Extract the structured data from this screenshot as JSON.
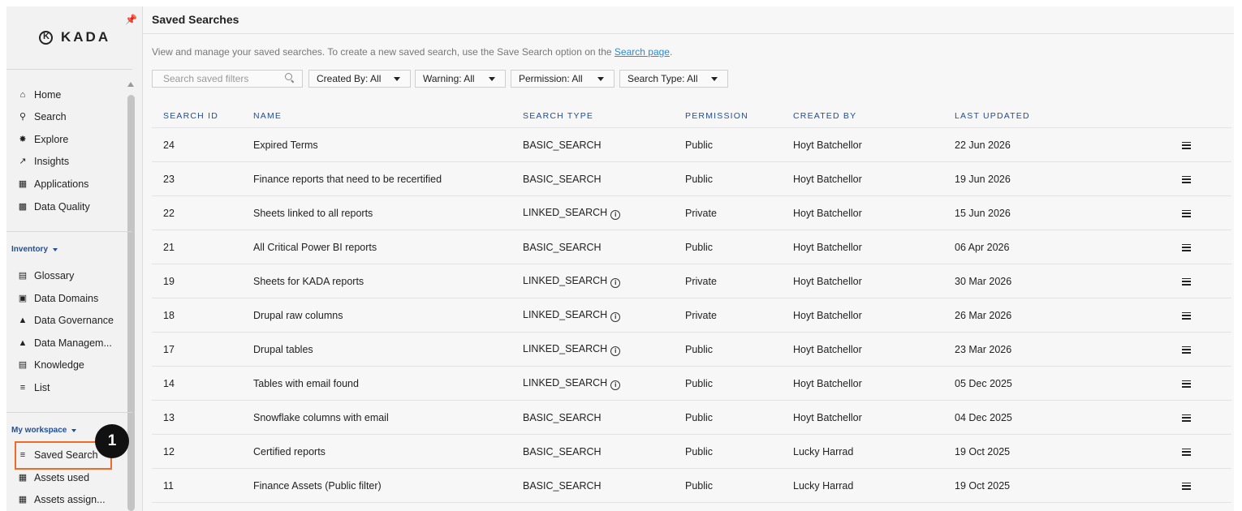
{
  "sidebar": {
    "logo_text": "KADA",
    "primary_nav": [
      {
        "label": "Home",
        "icon": "home-icon"
      },
      {
        "label": "Search",
        "icon": "search-icon"
      },
      {
        "label": "Explore",
        "icon": "explore-icon"
      },
      {
        "label": "Insights",
        "icon": "insights-icon"
      },
      {
        "label": "Applications",
        "icon": "applications-icon"
      },
      {
        "label": "Data Quality",
        "icon": "data-quality-icon"
      }
    ],
    "inventory_label": "Inventory",
    "inventory_nav": [
      {
        "label": "Glossary",
        "icon": "glossary-icon"
      },
      {
        "label": "Data Domains",
        "icon": "data-domains-icon"
      },
      {
        "label": "Data Governance",
        "icon": "data-governance-icon"
      },
      {
        "label": "Data Managem...",
        "icon": "data-management-icon"
      },
      {
        "label": "Knowledge",
        "icon": "knowledge-icon"
      },
      {
        "label": "List",
        "icon": "list-icon"
      }
    ],
    "workspace_label": "My workspace",
    "workspace_nav": [
      {
        "label": "Saved Search",
        "icon": "filter-icon"
      },
      {
        "label": "Assets used",
        "icon": "table-icon"
      },
      {
        "label": "Assets assign...",
        "icon": "table-icon"
      }
    ],
    "step_badge": "1"
  },
  "header": {
    "title": "Saved Searches",
    "subtitle_text": "View and manage your saved searches. To create a new saved search, use the Save Search option on the ",
    "subtitle_link": "Search page",
    "subtitle_end": "."
  },
  "filters": {
    "search_placeholder": "Search saved filters",
    "created_by": "Created By: All",
    "warning": "Warning: All",
    "permission": "Permission: All",
    "search_type": "Search Type: All"
  },
  "table": {
    "columns": [
      "SEARCH ID",
      "NAME",
      "SEARCH TYPE",
      "PERMISSION",
      "CREATED BY",
      "LAST UPDATED"
    ],
    "rows": [
      {
        "id": "24",
        "name": "Expired Terms",
        "type": "BASIC_SEARCH",
        "info": false,
        "permission": "Public",
        "created_by": "Hoyt Batchellor",
        "updated": "22 Jun 2026"
      },
      {
        "id": "23",
        "name": "Finance reports that need to be recertified",
        "type": "BASIC_SEARCH",
        "info": false,
        "permission": "Public",
        "created_by": "Hoyt Batchellor",
        "updated": "19 Jun 2026"
      },
      {
        "id": "22",
        "name": "Sheets linked to all reports",
        "type": "LINKED_SEARCH",
        "info": true,
        "permission": "Private",
        "created_by": "Hoyt Batchellor",
        "updated": "15 Jun 2026"
      },
      {
        "id": "21",
        "name": "All Critical Power BI reports",
        "type": "BASIC_SEARCH",
        "info": false,
        "permission": "Public",
        "created_by": "Hoyt Batchellor",
        "updated": "06 Apr 2026"
      },
      {
        "id": "19",
        "name": "Sheets for KADA reports",
        "type": "LINKED_SEARCH",
        "info": true,
        "permission": "Private",
        "created_by": "Hoyt Batchellor",
        "updated": "30 Mar 2026"
      },
      {
        "id": "18",
        "name": "Drupal raw columns",
        "type": "LINKED_SEARCH",
        "info": true,
        "permission": "Private",
        "created_by": "Hoyt Batchellor",
        "updated": "26 Mar 2026"
      },
      {
        "id": "17",
        "name": "Drupal tables",
        "type": "LINKED_SEARCH",
        "info": true,
        "permission": "Public",
        "created_by": "Hoyt Batchellor",
        "updated": "23 Mar 2026"
      },
      {
        "id": "14",
        "name": "Tables with email found",
        "type": "LINKED_SEARCH",
        "info": true,
        "permission": "Public",
        "created_by": "Hoyt Batchellor",
        "updated": "05 Dec 2025"
      },
      {
        "id": "13",
        "name": "Snowflake columns with email",
        "type": "BASIC_SEARCH",
        "info": false,
        "permission": "Public",
        "created_by": "Hoyt Batchellor",
        "updated": "04 Dec 2025"
      },
      {
        "id": "12",
        "name": "Certified reports",
        "type": "BASIC_SEARCH",
        "info": false,
        "permission": "Public",
        "created_by": "Lucky Harrad",
        "updated": "19 Oct 2025"
      },
      {
        "id": "11",
        "name": "Finance Assets (Public filter)",
        "type": "BASIC_SEARCH",
        "info": false,
        "permission": "Public",
        "created_by": "Lucky Harrad",
        "updated": "19 Oct 2025"
      }
    ]
  },
  "colors": {
    "accent_blue": "#1f4e9a",
    "link_blue": "#2a8bd8",
    "highlight_orange": "#f06a2a"
  }
}
